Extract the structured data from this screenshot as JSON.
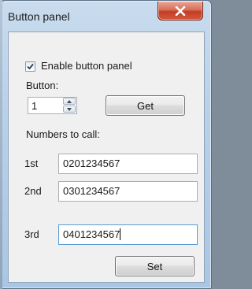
{
  "window": {
    "title": "Button panel",
    "close_glyph": "×"
  },
  "panel": {
    "enable_checkbox": {
      "label": "Enable button panel",
      "checked": true
    },
    "button_label": "Button:",
    "button_spinner_value": "1",
    "get_button_label": "Get",
    "numbers_label": "Numbers to call:",
    "numbers": [
      {
        "ordinal": "1st",
        "value": "0201234567"
      },
      {
        "ordinal": "2nd",
        "value": "0301234567"
      },
      {
        "ordinal": "3rd",
        "value": "0401234567"
      }
    ],
    "set_button_label": "Set"
  },
  "colors": {
    "title_bar": "#b9d0e8",
    "close_button": "#c9442c",
    "client_bg": "#f0f0f0",
    "focus_border": "#5b9bd5"
  }
}
